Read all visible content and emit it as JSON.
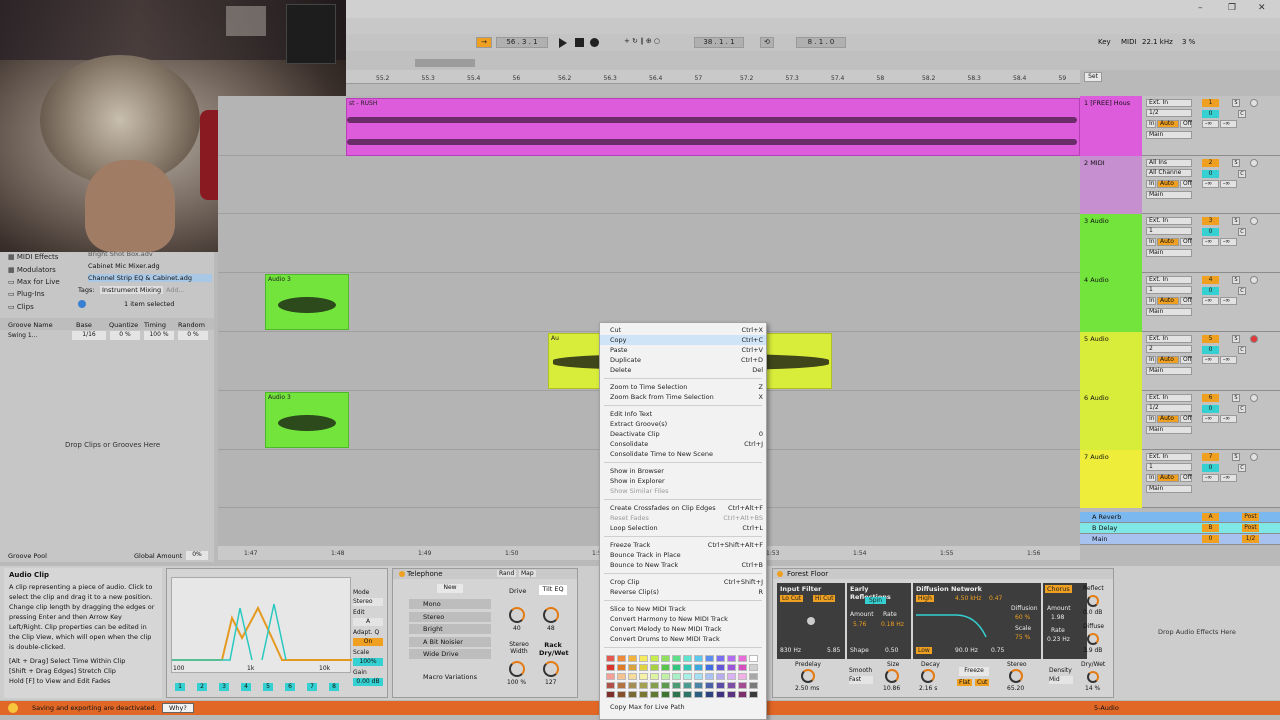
{
  "window": {
    "minimize": "–",
    "maximize": "❐",
    "close": "✕"
  },
  "transport": {
    "tempo_icon": "→",
    "position": "56 . 3 . 1",
    "loop_start": "38 . 1 . 1",
    "loop_len": "8 . 1 . 0",
    "key": "Key",
    "midi": "MIDI",
    "sample_rate": "22.1 kHz",
    "cpu": "3 %"
  },
  "ruler": [
    "55.2",
    "55.3",
    "55.4",
    "56",
    "56.2",
    "56.3",
    "56.4",
    "57",
    "57.2",
    "57.3",
    "57.4",
    "58",
    "58.2",
    "58.3",
    "58.4",
    "59"
  ],
  "timeline": [
    "1:47",
    "1:48",
    "1:49",
    "1:50",
    "1:51",
    "1:52",
    "1:53",
    "1:54",
    "1:55",
    "1:56"
  ],
  "browser": {
    "items": [
      "MIDI Effects",
      "Modulators",
      "Max for Live",
      "Plug-Ins",
      "Clips"
    ],
    "files": [
      "Bright Shot Box.adv",
      "Cabinet Mic Mixer.adg",
      "Channel Strip EQ & Cabinet.adg"
    ],
    "tags_label": "Tags:",
    "tags_value": "Instrument Mixing",
    "tags_add": "Add...",
    "selection": "1 item selected",
    "groove_cols": [
      "Groove Name",
      "Base",
      "Quantize",
      "Timing",
      "Random"
    ],
    "groove_row": [
      "Swing 1...",
      "1/16",
      "0 %",
      "100 %",
      "0 %"
    ],
    "drop_text": "Drop Clips or Grooves Here",
    "groove_pool": "Groove Pool",
    "global_amount": "Global Amount",
    "global_amount_val": "0%",
    "set_btn": "Set"
  },
  "tracks": [
    {
      "name": "1 [FREE] Hous",
      "input": "Ext. In",
      "chan": "1/2",
      "num": "1",
      "color": "#dc5cdb"
    },
    {
      "name": "2 MIDI",
      "input": "All Ins",
      "chan": "All Channe",
      "num": "2",
      "color": "#c58fd0"
    },
    {
      "name": "3 Audio",
      "input": "Ext. In",
      "chan": "1",
      "num": "3",
      "color": "#72e43c"
    },
    {
      "name": "4 Audio",
      "input": "Ext. In",
      "chan": "1",
      "num": "4",
      "color": "#72e43c"
    },
    {
      "name": "5 Audio",
      "input": "Ext. In",
      "chan": "2",
      "num": "5",
      "color": "#d8ec3a"
    },
    {
      "name": "6 Audio",
      "input": "Ext. In",
      "chan": "1/2",
      "num": "6",
      "color": "#d8ec3a"
    },
    {
      "name": "7 Audio",
      "input": "Ext. In",
      "chan": "1",
      "num": "7",
      "color": "#eeee3a"
    }
  ],
  "track_io": {
    "in": "In",
    "auto": "Auto",
    "off": "Off",
    "main": "Main",
    "inf": "-∞",
    "s": "S",
    "c": "C"
  },
  "returns": [
    {
      "name": "A Reverb",
      "letter": "A",
      "post": "Post"
    },
    {
      "name": "B Delay",
      "letter": "B",
      "post": "Post"
    },
    {
      "name": "Main",
      "letter": "0",
      "post": "1/2"
    }
  ],
  "clips": {
    "rush": "st - RUSH",
    "audio3": "Audio 3",
    "audio_short": "Au"
  },
  "context_menu": {
    "groups": [
      [
        {
          "label": "Cut",
          "sc": "Ctrl+X"
        },
        {
          "label": "Copy",
          "sc": "Ctrl+C",
          "hl": true
        },
        {
          "label": "Paste",
          "sc": "Ctrl+V"
        },
        {
          "label": "Duplicate",
          "sc": "Ctrl+D"
        },
        {
          "label": "Delete",
          "sc": "Del"
        }
      ],
      [
        {
          "label": "Zoom to Time Selection",
          "sc": "Z"
        },
        {
          "label": "Zoom Back from Time Selection",
          "sc": "X"
        }
      ],
      [
        {
          "label": "Edit Info Text",
          "sc": ""
        },
        {
          "label": "Extract Groove(s)",
          "sc": ""
        },
        {
          "label": "Deactivate Clip",
          "sc": "0"
        },
        {
          "label": "Consolidate",
          "sc": "Ctrl+J"
        },
        {
          "label": "Consolidate Time to New Scene",
          "sc": ""
        }
      ],
      [
        {
          "label": "Show in Browser",
          "sc": ""
        },
        {
          "label": "Show in Explorer",
          "sc": ""
        },
        {
          "label": "Show Similar Files",
          "sc": "",
          "dis": true
        }
      ],
      [
        {
          "label": "Create Crossfades on Clip Edges",
          "sc": "Ctrl+Alt+F"
        },
        {
          "label": "Reset Fades",
          "sc": "Ctrl+Alt+BS",
          "dis": true
        },
        {
          "label": "Loop Selection",
          "sc": "Ctrl+L"
        }
      ],
      [
        {
          "label": "Freeze Track",
          "sc": "Ctrl+Shift+Alt+F"
        },
        {
          "label": "Bounce Track in Place",
          "sc": ""
        },
        {
          "label": "Bounce to New Track",
          "sc": "Ctrl+B"
        }
      ],
      [
        {
          "label": "Crop Clip",
          "sc": "Ctrl+Shift+J"
        },
        {
          "label": "Reverse Clip(s)",
          "sc": "R"
        }
      ],
      [
        {
          "label": "Slice to New MIDI Track",
          "sc": ""
        },
        {
          "label": "Convert Harmony to New MIDI Track",
          "sc": ""
        },
        {
          "label": "Convert Melody to New MIDI Track",
          "sc": ""
        },
        {
          "label": "Convert Drums to New MIDI Track",
          "sc": ""
        }
      ]
    ],
    "footer": "Copy Max for Live Path",
    "colors": [
      "#e4584f",
      "#ef8a3a",
      "#f2b43a",
      "#f5ea5e",
      "#c6ec4e",
      "#8fe05c",
      "#5ee08a",
      "#5fe5cf",
      "#5ec9ef",
      "#5a8ff0",
      "#7a6ff0",
      "#b36df0",
      "#ea6cd6",
      "#ffffff",
      "#d9352d",
      "#e07b25",
      "#d8a23d",
      "#e0d33e",
      "#a5d23e",
      "#58c64d",
      "#34c57f",
      "#33c7b6",
      "#3ca8de",
      "#3f6ee2",
      "#6356d9",
      "#9c56d9",
      "#d54fbf",
      "#d0d0d0",
      "#f59f97",
      "#f6c290",
      "#f5dc9a",
      "#f5f1a7",
      "#def3a2",
      "#bff0a6",
      "#a8efc5",
      "#a7f0e6",
      "#a5dff4",
      "#a8c2f4",
      "#b5acf4",
      "#dcb0f4",
      "#f2b1e6",
      "#a7a7a7",
      "#b1524a",
      "#b27340",
      "#a58e52",
      "#a3a052",
      "#85a04c",
      "#5e9a4d",
      "#4c9b73",
      "#4a9a8f",
      "#4a85a6",
      "#4a62a8",
      "#5c4ea6",
      "#7d4ea6",
      "#a34c92",
      "#7a7a7a",
      "#7f2f29",
      "#86512a",
      "#7b6933",
      "#7a7830",
      "#5f7a30",
      "#3e7431",
      "#2f744f",
      "#2d7468",
      "#2b5f80",
      "#2c4380",
      "#3d3381",
      "#5b3381",
      "#7c2f6c",
      "#3a3a3a"
    ]
  },
  "clip_info": {
    "title": "Audio Clip",
    "desc": "A clip representing a piece of audio. Click to select the clip and drag it to a new position. Change clip length by dragging the edges or pressing Enter and then Arrow Key Left/Right. Clip properties can be edited in the Clip View, which will open when the clip is double-clicked.",
    "hints": [
      "[Alt + Drag] Select Time Within Clip",
      "[Shift + Drag Edges] Stretch Clip",
      "Hold [F] to View and Edit Fades"
    ]
  },
  "eq": {
    "mode": "Mode",
    "mode_val": "Stereo",
    "edit": "Edit",
    "edit_val": "A",
    "adapt": "Adapt. Q",
    "adapt_val": "On",
    "scale": "Scale",
    "scale_val": "100%",
    "gain": "Gain",
    "gain_val": "0.00 dB",
    "freqs": [
      "100",
      "1k",
      "10k"
    ],
    "bands": [
      "1",
      "2",
      "3",
      "4",
      "5",
      "6",
      "7",
      "8"
    ]
  },
  "telephone": {
    "title": "Telephone",
    "new": "New",
    "rand": "Rand",
    "map": "Map",
    "presets": [
      "Mono",
      "Stereo",
      "Bright",
      "A Bit Noisier",
      "Wide Drive"
    ],
    "macro": "Macro Variations",
    "drive": "Drive",
    "tilt": "Tilt EQ",
    "drive_val": "40",
    "tilt_val": "48",
    "width": "Stereo Width",
    "rack": "Rack Dry/Wet",
    "width_val": "100 %",
    "rack_val": "127"
  },
  "reverb": {
    "title": "Forest Floor",
    "input_filter": "Input Filter",
    "lo_cut": "Lo Cut",
    "hi_cut": "Hi Cut",
    "lo_val": "830 Hz",
    "hi_val": "5.85",
    "early": "Early Reflections",
    "spin": "Spin",
    "amount": "Amount",
    "rate": "Rate",
    "amount_val": "5.76",
    "rate_val": "0.18 Hz",
    "shape": "Shape",
    "shape_val": "0.50",
    "diffusion": "Diffusion Network",
    "high": "High",
    "low": "Low",
    "hz": "4.50 kHz",
    "hz2": "0.47",
    "diff": "Diffusion",
    "diff_val": "60 %",
    "sc": "Scale",
    "sc_val": "75 %",
    "dnv1": "90.0 Hz",
    "dnv2": "0.75",
    "chorus": "Chorus",
    "ch_amount": "Amount",
    "ch_amount_val": "1.98",
    "ch_rate": "Rate",
    "ch_rate_val": "0.23 Hz",
    "reflect": "Reflect",
    "reflect_val": "0.0 dB",
    "diffuse": "Diffuse",
    "diffuse_val": "3.9 dB",
    "drywet": "Dry/Wet",
    "drywet_val": "14 %",
    "predelay": "Predelay",
    "predelay_val": "2.50 ms",
    "smooth": "Smooth",
    "smooth_val": "Fast",
    "size": "Size",
    "size_val": "10.86",
    "decay": "Decay",
    "decay_val": "2.16 s",
    "freeze": "Freeze",
    "flat": "Flat",
    "cut": "Cut",
    "stereo": "Stereo",
    "stereo_val": "65.20",
    "density": "Density",
    "density_val": "Mid",
    "drop_text": "Drop Audio Effects Here"
  },
  "status": {
    "msg": "Saving and exporting are deactivated.",
    "why": "Why?",
    "track": "5-Audio"
  }
}
